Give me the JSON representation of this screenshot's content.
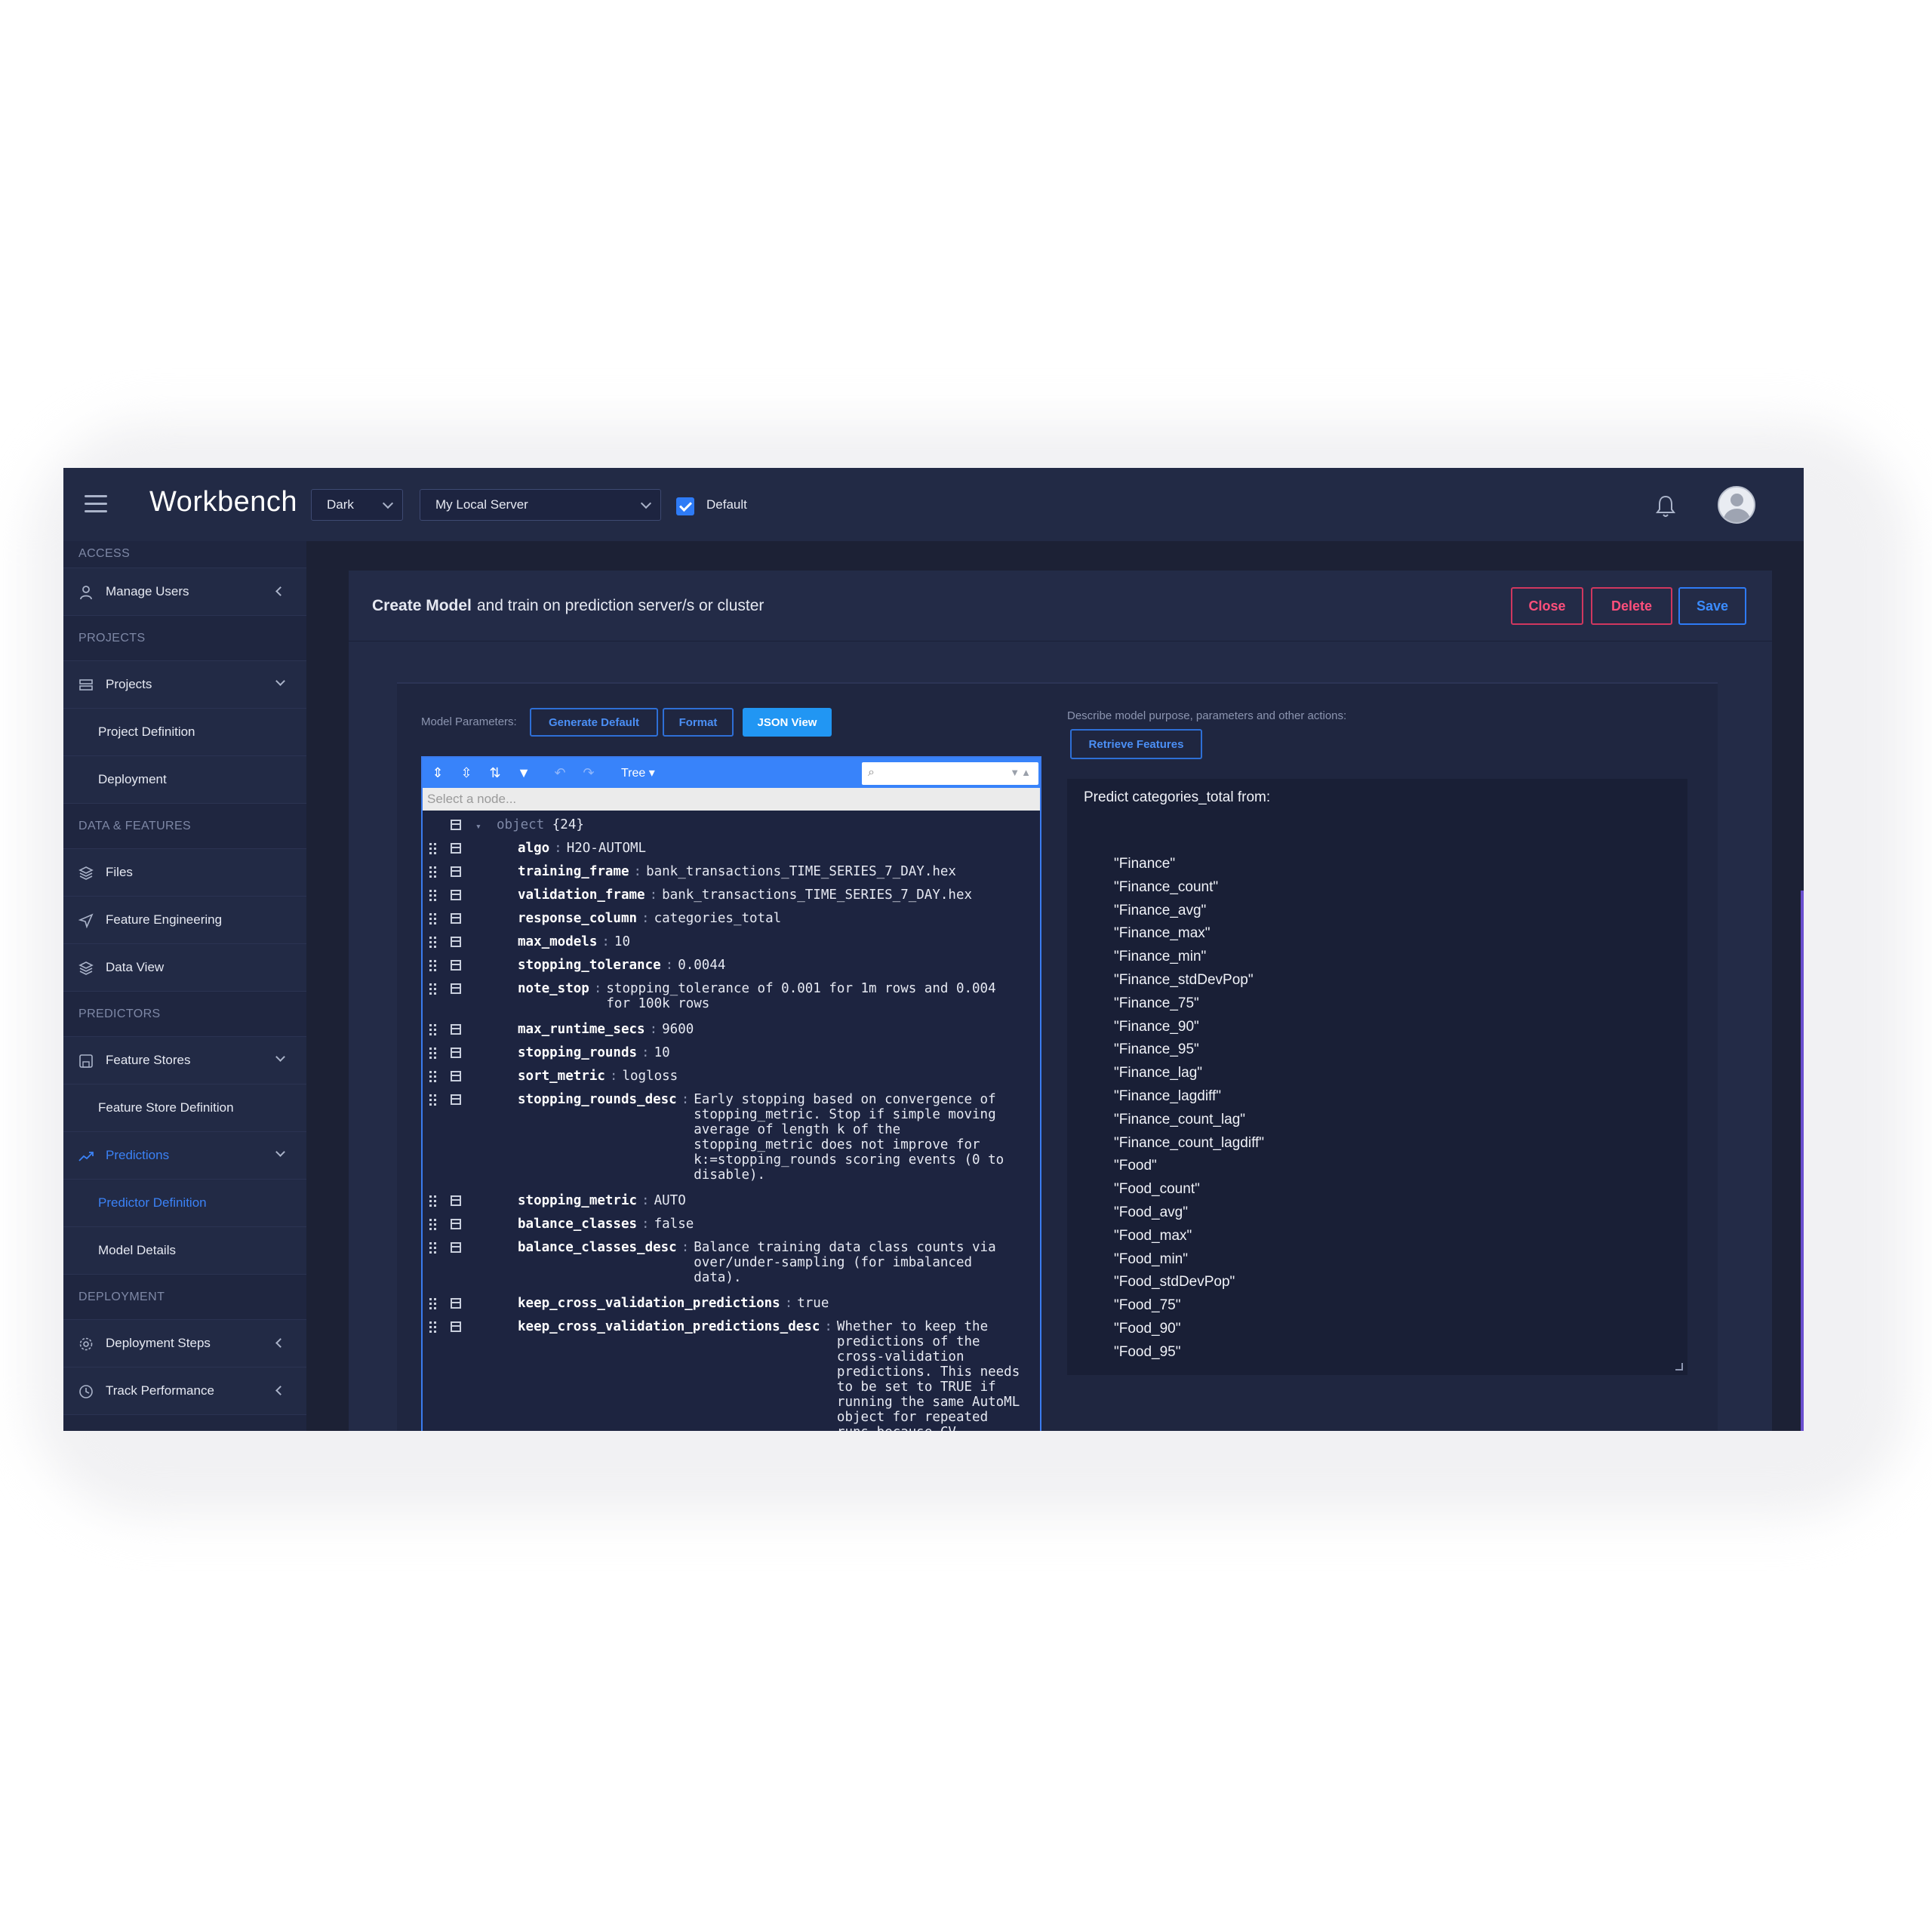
{
  "app": {
    "title": "Workbench",
    "theme_select": "Dark",
    "server_select": "My Local Server",
    "default_checkbox_label": "Default",
    "default_checked": true
  },
  "sidebar": {
    "sections": {
      "access": "ACCESS",
      "projects": "PROJECTS",
      "data_features": "DATA & FEATURES",
      "predictors": "PREDICTORS",
      "deployment": "DEPLOYMENT"
    },
    "items": {
      "manage_users": "Manage Users",
      "projects": "Projects",
      "project_definition": "Project Definition",
      "deployment": "Deployment",
      "files": "Files",
      "feature_engineering": "Feature Engineering",
      "data_view": "Data View",
      "feature_stores": "Feature Stores",
      "feature_store_definition": "Feature Store Definition",
      "predictions": "Predictions",
      "predictor_definition": "Predictor Definition",
      "model_details": "Model Details",
      "deployment_steps": "Deployment Steps",
      "track_performance": "Track Performance"
    }
  },
  "panel": {
    "title_bold": "Create Model",
    "title_rest": "and train on prediction server/s or cluster",
    "close_label": "Close",
    "delete_label": "Delete",
    "save_label": "Save"
  },
  "model_params": {
    "label": "Model Parameters:",
    "generate_default": "Generate Default",
    "format": "Format",
    "json_view": "JSON View"
  },
  "editor": {
    "mode": "Tree",
    "nav_placeholder": "Select a node...",
    "root": {
      "type": "object",
      "count": "{24}"
    },
    "rows": [
      {
        "key": "algo",
        "val": "H2O-AUTOML"
      },
      {
        "key": "training_frame",
        "val": "bank_transactions_TIME_SERIES_7_DAY.hex"
      },
      {
        "key": "validation_frame",
        "val": "bank_transactions_TIME_SERIES_7_DAY.hex"
      },
      {
        "key": "response_column",
        "val": "categories_total"
      },
      {
        "key": "max_models",
        "val": "10"
      },
      {
        "key": "stopping_tolerance",
        "val": "0.0044"
      },
      {
        "key": "note_stop",
        "val": "stopping_tolerance of 0.001 for 1m rows and 0.004\nfor 100k rows"
      },
      {
        "key": "max_runtime_secs",
        "val": "9600"
      },
      {
        "key": "stopping_rounds",
        "val": "10"
      },
      {
        "key": "sort_metric",
        "val": "logloss"
      },
      {
        "key": "stopping_rounds_desc",
        "val": "Early stopping based on convergence of\nstopping_metric. Stop if simple moving\naverage of length k of the\nstopping_metric does not improve for\nk:=stopping_rounds scoring events (0 to\ndisable)."
      },
      {
        "key": "stopping_metric",
        "val": "AUTO"
      },
      {
        "key": "balance_classes",
        "val": "false"
      },
      {
        "key": "balance_classes_desc",
        "val": "Balance training data class counts via\nover/under-sampling (for imbalanced\ndata)."
      },
      {
        "key": "keep_cross_validation_predictions",
        "val": "true"
      },
      {
        "key": "keep_cross_validation_predictions_desc",
        "val": "Whether to keep the\npredictions of the\ncross-validation\npredictions. This needs\nto be set to TRUE if\nrunning the same AutoML\nobject for repeated\nruns because CV"
      }
    ]
  },
  "description": {
    "label": "Describe model purpose, parameters and other actions:",
    "retrieve_label": "Retrieve Features",
    "title": "Predict categories_total from:",
    "features": [
      "\"Finance\"",
      "\"Finance_count\"",
      "\"Finance_avg\"",
      "\"Finance_max\"",
      "\"Finance_min\"",
      "\"Finance_stdDevPop\"",
      "\"Finance_75\"",
      "\"Finance_90\"",
      "\"Finance_95\"",
      "\"Finance_lag\"",
      "\"Finance_lagdiff\"",
      "\"Finance_count_lag\"",
      "\"Finance_count_lagdiff\"",
      "\"Food\"",
      "\"Food_count\"",
      "\"Food_avg\"",
      "\"Food_max\"",
      "\"Food_min\"",
      "\"Food_stdDevPop\"",
      "\"Food_75\"",
      "\"Food_90\"",
      "\"Food_95\""
    ]
  },
  "colors": {
    "accent": "#2e7bf6",
    "danger": "#ff4f7b",
    "background": "#1c2135"
  }
}
